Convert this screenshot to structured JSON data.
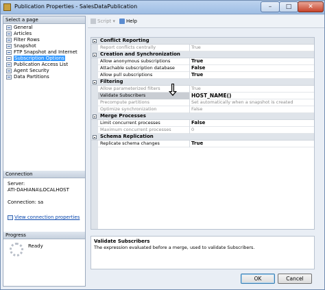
{
  "window": {
    "title": "Publication Properties - SalesDataPublication"
  },
  "left": {
    "select_page_header": "Select a page",
    "pages": [
      "General",
      "Articles",
      "Filter Rows",
      "Snapshot",
      "FTP Snapshot and Internet",
      "Subscription Options",
      "Publication Access List",
      "Agent Security",
      "Data Partitions"
    ],
    "selected_page": "Subscription Options",
    "connection_header": "Connection",
    "server_label": "Server:",
    "server_value": "ATI-DAHIANA\\LOCALHOST",
    "connection_text": "Connection: sa",
    "view_link": "View connection properties",
    "progress_header": "Progress",
    "progress_status": "Ready"
  },
  "toolbar": {
    "script_label": "Script",
    "help_label": "Help"
  },
  "grid": {
    "categories": [
      {
        "name": "Conflict Reporting",
        "rows": [
          {
            "name": "Report conflicts centrally",
            "value": "True",
            "state": "disabled"
          }
        ]
      },
      {
        "name": "Creation and Synchronization",
        "rows": [
          {
            "name": "Allow anonymous subscriptions",
            "value": "True",
            "state": "bold"
          },
          {
            "name": "Attachable subscription database",
            "value": "False",
            "state": "bold"
          },
          {
            "name": "Allow pull subscriptions",
            "value": "True",
            "state": "bold"
          }
        ]
      },
      {
        "name": "Filtering",
        "rows": [
          {
            "name": "Allow parameterized filters",
            "value": "True",
            "state": "disabled"
          },
          {
            "name": "Validate Subscribers",
            "value": "HOST_NAME()",
            "state": "selected"
          },
          {
            "name": "Precompute partitions",
            "value": "Set automatically when a snapshot is created",
            "state": "disabled"
          },
          {
            "name": "Optimize synchronization",
            "value": "False",
            "state": "disabled"
          }
        ]
      },
      {
        "name": "Merge Processes",
        "rows": [
          {
            "name": "Limit concurrent processes",
            "value": "False",
            "state": "bold"
          },
          {
            "name": "Maximum concurrent processes",
            "value": "0",
            "state": "disabled"
          }
        ]
      },
      {
        "name": "Schema Replication",
        "rows": [
          {
            "name": "Replicate schema changes",
            "value": "True",
            "state": "bold"
          }
        ]
      }
    ]
  },
  "description": {
    "title": "Validate Subscribers",
    "text": "The expression evaluated before a merge, used to validate Subscribers."
  },
  "footer": {
    "ok_label": "OK",
    "cancel_label": "Cancel"
  },
  "icons": {
    "window": "publication-icon",
    "page": "page-icon",
    "script": "script-icon",
    "help": "help-icon",
    "link": "connection-icon",
    "progress": "spinner-icon",
    "annotation": "down-arrow-icon"
  },
  "colors": {
    "selection": "#3399ff",
    "category_band": "#dfe4ea",
    "link": "#0645ad"
  }
}
